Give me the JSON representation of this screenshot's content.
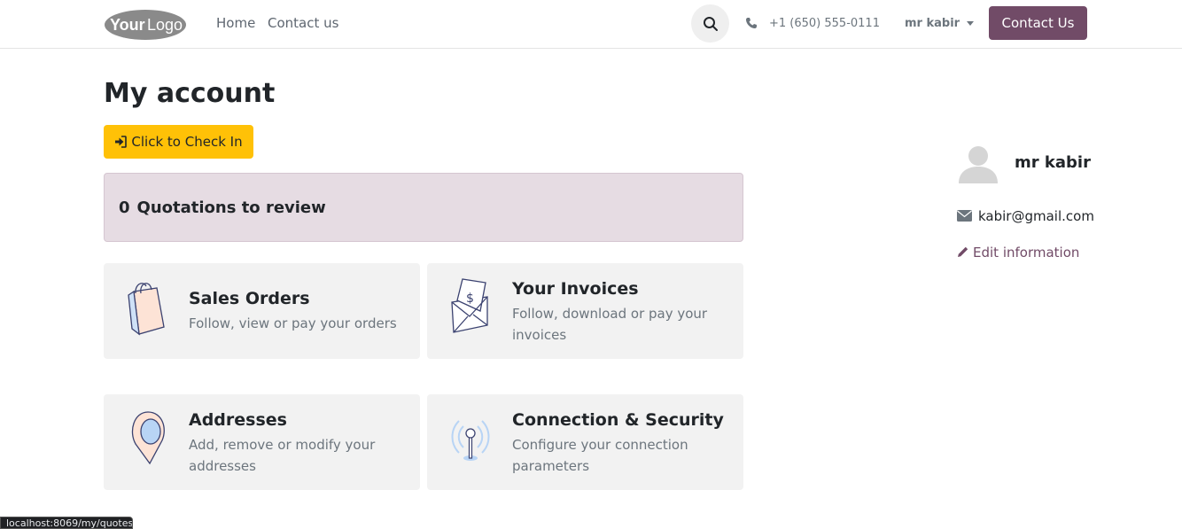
{
  "navbar": {
    "logo_alt": "YourLogo",
    "links": [
      {
        "label": "Home"
      },
      {
        "label": "Contact us"
      }
    ],
    "search_icon": "search-icon",
    "phone": "+1 (650) 555-0111",
    "user_menu": "mr kabir",
    "contact_button": "Contact Us",
    "brand_color": "#714b67"
  },
  "main": {
    "title": "My account",
    "checkin_button": "Click to Check In",
    "quotations": {
      "count": "0",
      "label": "Quotations to review"
    },
    "cards": [
      {
        "title": "Sales Orders",
        "description": "Follow, view or pay your orders",
        "icon": "shopping-bag-icon"
      },
      {
        "title": "Your Invoices",
        "description": "Follow, download or pay your invoices",
        "icon": "invoice-envelope-icon"
      },
      {
        "title": "Addresses",
        "description": "Add, remove or modify your addresses",
        "icon": "map-pin-icon"
      },
      {
        "title": "Connection & Security",
        "description": "Configure your connection parameters",
        "icon": "antenna-icon"
      }
    ]
  },
  "profile": {
    "name": "mr kabir",
    "email": "kabir@gmail.com",
    "edit_label": "Edit information"
  },
  "status_bar": {
    "url": "localhost:8069/my/quotes"
  }
}
